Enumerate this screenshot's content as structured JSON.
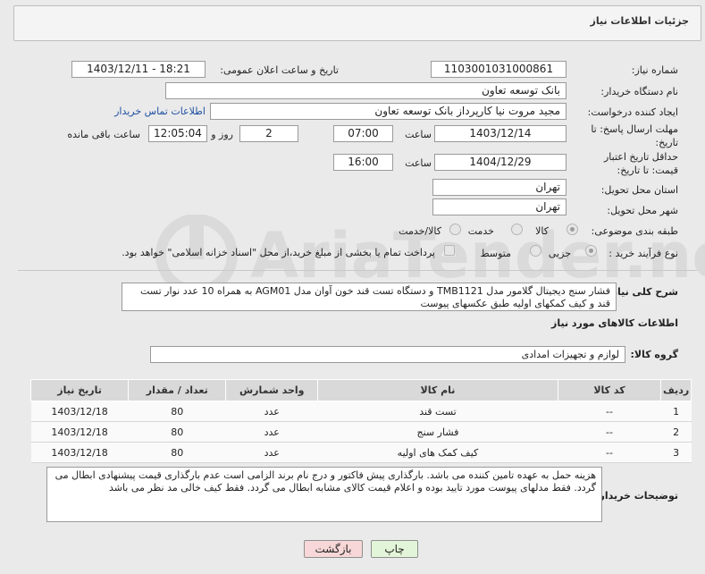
{
  "header": {
    "title": "جزئیات اطلاعات نیاز"
  },
  "form": {
    "need_number_label": "شماره نیاز:",
    "need_number": "1103001031000861",
    "announce_label": "تاریخ و ساعت اعلان عمومی:",
    "announce_value": "1403/12/11 - 18:21",
    "buyer_label": "نام دستگاه خریدار:",
    "buyer_value": "بانک توسعه تعاون",
    "creator_label": "ایجاد کننده درخواست:",
    "creator_value": "مجید مروت نیا کارپرداز بانک توسعه تعاون",
    "contact_link": "اطلاعات تماس خریدار",
    "deadline_label": "مهلت ارسال پاسخ: تا تاریخ:",
    "deadline_date": "1403/12/14",
    "time_label": "ساعت",
    "deadline_time": "07:00",
    "days_value": "2",
    "days_label": "روز و",
    "remaining_time": "12:05:04",
    "remaining_label": "ساعت باقی مانده",
    "validity_label": "حداقل تاریخ اعتبار قیمت: تا تاریخ:",
    "validity_date": "1404/12/29",
    "validity_time": "16:00",
    "province_label": "استان محل تحویل:",
    "province_value": "تهران",
    "city_label": "شهر محل تحویل:",
    "city_value": "تهران",
    "category_label": "طبقه بندی موضوعی:",
    "category_options": [
      "کالا",
      "خدمت",
      "کالا/خدمت"
    ],
    "purchase_type_label": "نوع فرآیند خرید :",
    "purchase_options": [
      "جزیی",
      "متوسط"
    ],
    "payment_note": "پرداخت تمام یا بخشی از مبلغ خرید،از محل \"اسناد خزانه اسلامی\" خواهد بود."
  },
  "summary": {
    "label": "شرح کلی نیاز:",
    "text": "فشار سنج دیجیتال گلامور مدل TMB1121 و دستگاه تست قند خون آوان مدل AGM01 به همراه 10 عدد نوار تست قند و کیف کمکهای اولیه طبق عکسهای پیوست"
  },
  "goods": {
    "section_title": "اطلاعات کالاهای مورد نیاز",
    "group_label": "گروه کالا:",
    "group_value": "لوازم و تجهیزات امدادی",
    "columns": [
      "ردیف",
      "کد کالا",
      "نام کالا",
      "واحد شمارش",
      "تعداد / مقدار",
      "تاریخ نیاز"
    ],
    "rows": [
      {
        "row": "1",
        "code": "--",
        "name": "تست قند",
        "unit": "عدد",
        "qty": "80",
        "date": "1403/12/18"
      },
      {
        "row": "2",
        "code": "--",
        "name": "فشار سنج",
        "unit": "عدد",
        "qty": "80",
        "date": "1403/12/18"
      },
      {
        "row": "3",
        "code": "--",
        "name": "کیف کمک های اولیه",
        "unit": "عدد",
        "qty": "80",
        "date": "1403/12/18"
      }
    ]
  },
  "buyer_notes": {
    "label": "توضیحات خریدار:",
    "text": "هزینه حمل به عهده تامین کننده می باشد. بارگذاری پیش فاکتور و درج نام برند الزامی است عدم بارگذاری قیمت پیشنهادی ابطال می گردد. فقط مدلهای پیوست مورد تایید بوده و اعلام قیمت کالای مشابه ابطال می گردد. فقط کیف خالی مد نظر می باشد"
  },
  "buttons": {
    "print": "چاپ",
    "back": "بازگشت"
  },
  "colors": {
    "back_button_bg": "#f7d7d7",
    "print_button_bg": "#e3f5d8",
    "link": "#1f4fa3"
  }
}
